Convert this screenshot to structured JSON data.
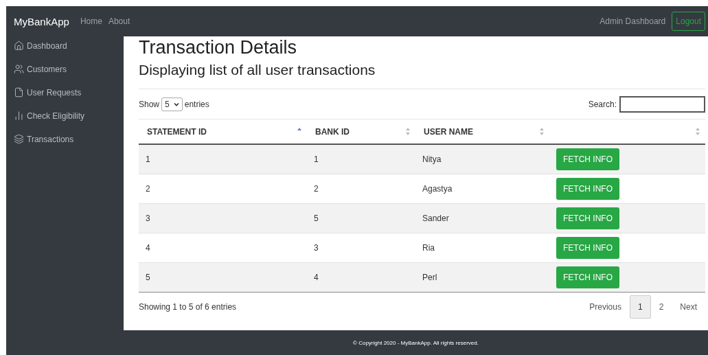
{
  "navbar": {
    "brand": "MyBankApp",
    "links": [
      "Home",
      "About"
    ],
    "right_label": "Admin Dashboard",
    "logout": "Logout"
  },
  "sidebar": {
    "items": [
      {
        "label": "Dashboard"
      },
      {
        "label": "Customers"
      },
      {
        "label": "User Requests"
      },
      {
        "label": "Check Eligibility"
      },
      {
        "label": "Transactions"
      }
    ]
  },
  "title": "Transaction Details",
  "subtitle": "Displaying list of all user transactions",
  "length": {
    "show": "Show",
    "value": "5",
    "entries": "entries"
  },
  "search": {
    "label": "Search:"
  },
  "table": {
    "columns": [
      {
        "label": "STATEMENT ID",
        "sorted": true
      },
      {
        "label": "BANK ID",
        "sorted": false
      },
      {
        "label": "USER NAME",
        "sorted": false
      },
      {
        "sorted": false
      }
    ],
    "rows": [
      {
        "cells": [
          "1",
          "1",
          "Nitya"
        ],
        "action": "FETCH INFO"
      },
      {
        "cells": [
          "2",
          "2",
          "Agastya"
        ],
        "action": "FETCH INFO"
      },
      {
        "cells": [
          "3",
          "5",
          "Sander"
        ],
        "action": "FETCH INFO"
      },
      {
        "cells": [
          "4",
          "3",
          "Ria"
        ],
        "action": "FETCH INFO"
      },
      {
        "cells": [
          "5",
          "4",
          "Perl"
        ],
        "action": "FETCH INFO"
      }
    ]
  },
  "info": "Showing 1 to 5 of 6 entries",
  "pagination": {
    "previous": "Previous",
    "pages": [
      {
        "label": "1",
        "selected": true
      },
      {
        "label": "2",
        "selected": false
      }
    ],
    "next": "Next"
  },
  "footer": "© Copyright 2020 - MyBankApp. All rights reserved."
}
